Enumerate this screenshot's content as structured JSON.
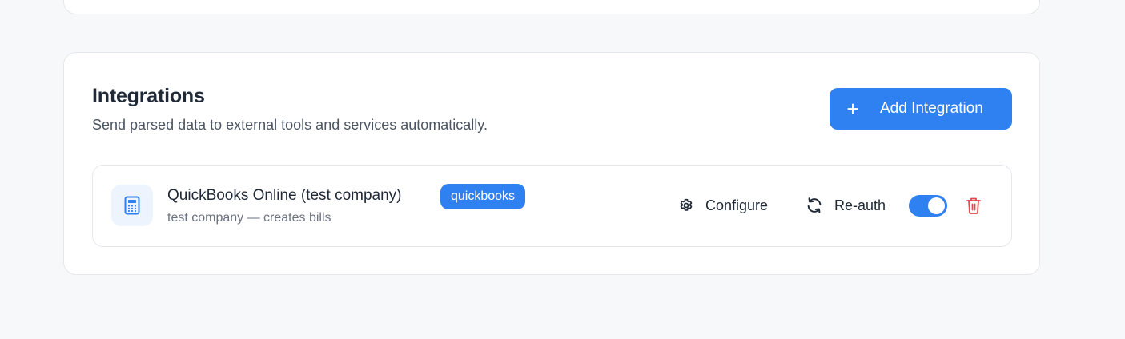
{
  "integrations": {
    "title": "Integrations",
    "subtitle": "Send parsed data to external tools and services automatically.",
    "add_button": {
      "icon": "plus-icon",
      "label": "Add Integration"
    },
    "items": [
      {
        "icon": "calculator-icon",
        "name": "QuickBooks Online (test company)",
        "badge": "quickbooks",
        "description": "test company — creates bills",
        "configure_label": "Configure",
        "reauth_label": "Re-auth",
        "enabled": true
      }
    ]
  },
  "colors": {
    "accent": "#2f80f0",
    "danger": "#e5484d",
    "page_background": "#f7f8fa",
    "card_border": "#e5e7eb",
    "icon_tile": "#eef4fd"
  }
}
